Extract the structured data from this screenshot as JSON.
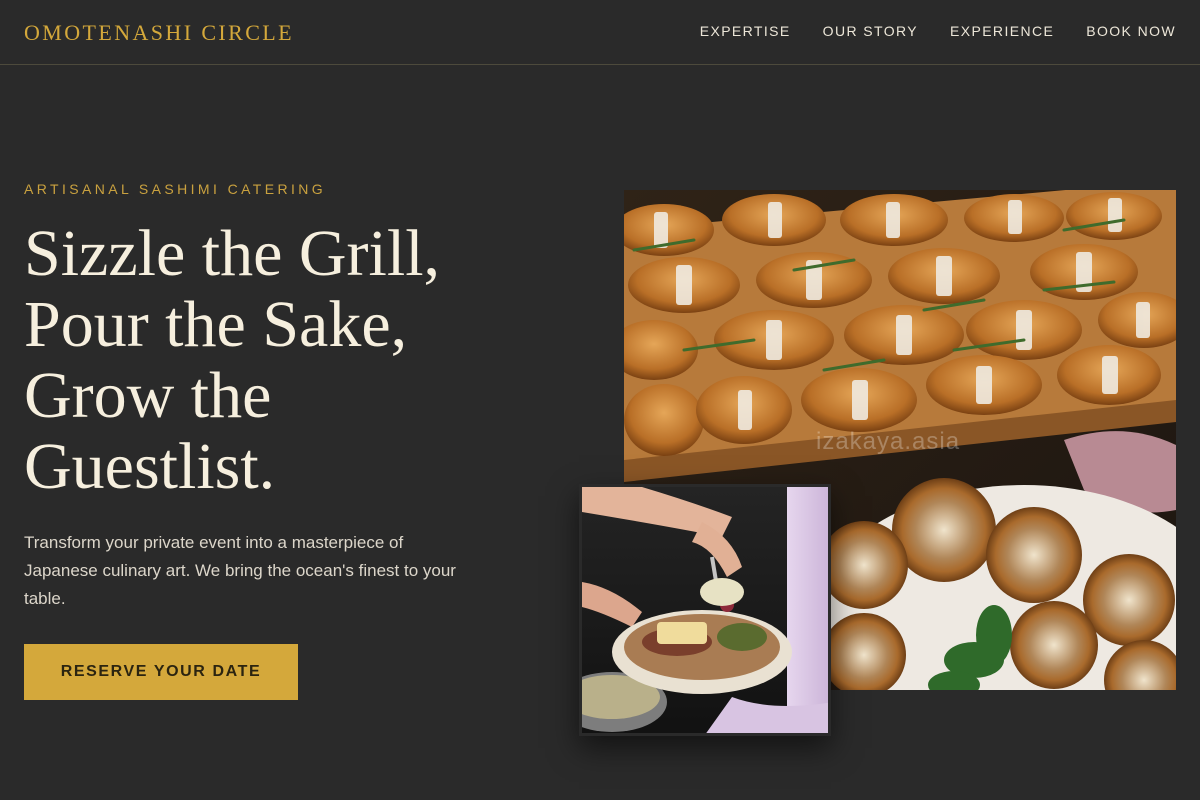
{
  "header": {
    "brand": "OMOTENASHI CIRCLE",
    "nav": [
      "EXPERTISE",
      "OUR STORY",
      "EXPERIENCE",
      "BOOK NOW"
    ]
  },
  "hero": {
    "eyebrow": "ARTISANAL SASHIMI CATERING",
    "headline_lines": [
      "Sizzle the Grill,",
      "Pour the Sake,",
      "Grow the",
      "Guestlist."
    ],
    "lead": "Transform your private event into a masterpiece of Japanese culinary art. We bring the ocean's finest to your table.",
    "cta_label": "RESERVE YOUR DATE"
  },
  "gallery": {
    "watermark": "izakaya.asia",
    "images": [
      {
        "subject": "croissant sandwiches tied with twine and rosemary on a wooden board; tartlets with cream and cocoa on a white plate"
      },
      {
        "subject": "hands serving a plate of grilled food with a spoon of rice"
      }
    ]
  },
  "colors": {
    "background": "#2a2a2a",
    "accent": "#d4a83b",
    "headline": "#f6efde",
    "body_text": "#dcd6ca"
  }
}
